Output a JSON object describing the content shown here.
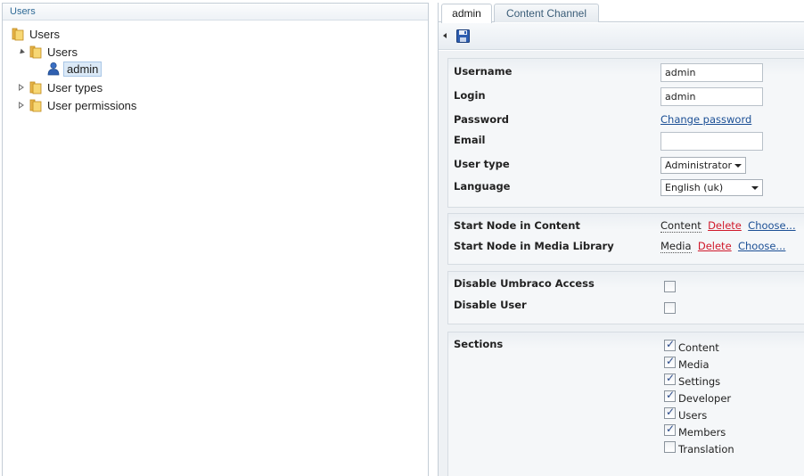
{
  "left_panel": {
    "header": "Users",
    "tree": {
      "root": "Users",
      "users_folder": "Users",
      "admin": "admin",
      "user_types": "User types",
      "user_permissions": "User permissions"
    }
  },
  "tabs": [
    {
      "label": "admin",
      "active": true
    },
    {
      "label": "Content Channel",
      "active": false
    }
  ],
  "toolbar": {
    "icons": [
      "left-arrow-icon",
      "save-icon"
    ]
  },
  "user_details": {
    "username_label": "Username",
    "username_value": "admin",
    "login_label": "Login",
    "login_value": "admin",
    "password_label": "Password",
    "password_link": "Change password",
    "email_label": "Email",
    "email_value": "",
    "user_type_label": "User type",
    "user_type_value": "Administrator",
    "language_label": "Language",
    "language_value": "English (uk)"
  },
  "start_nodes": {
    "content_label": "Start Node in Content",
    "content_value": "Content",
    "content_delete": "Delete",
    "content_choose": "Choose...",
    "media_label": "Start Node in Media Library",
    "media_value": "Media",
    "media_delete": "Delete",
    "media_choose": "Choose..."
  },
  "access": {
    "disable_umbraco_label": "Disable Umbraco Access",
    "disable_umbraco_checked": false,
    "disable_user_label": "Disable User",
    "disable_user_checked": false
  },
  "sections": {
    "label": "Sections",
    "items": [
      {
        "label": "Content",
        "checked": true
      },
      {
        "label": "Media",
        "checked": true
      },
      {
        "label": "Settings",
        "checked": true
      },
      {
        "label": "Developer",
        "checked": true
      },
      {
        "label": "Users",
        "checked": true
      },
      {
        "label": "Members",
        "checked": true
      },
      {
        "label": "Translation",
        "checked": false
      }
    ]
  },
  "colors": {
    "accent_link": "#1b4f95",
    "delete_red": "#d0182a",
    "header_text": "#2f6a96",
    "panel_bg": "#eef1f4"
  }
}
